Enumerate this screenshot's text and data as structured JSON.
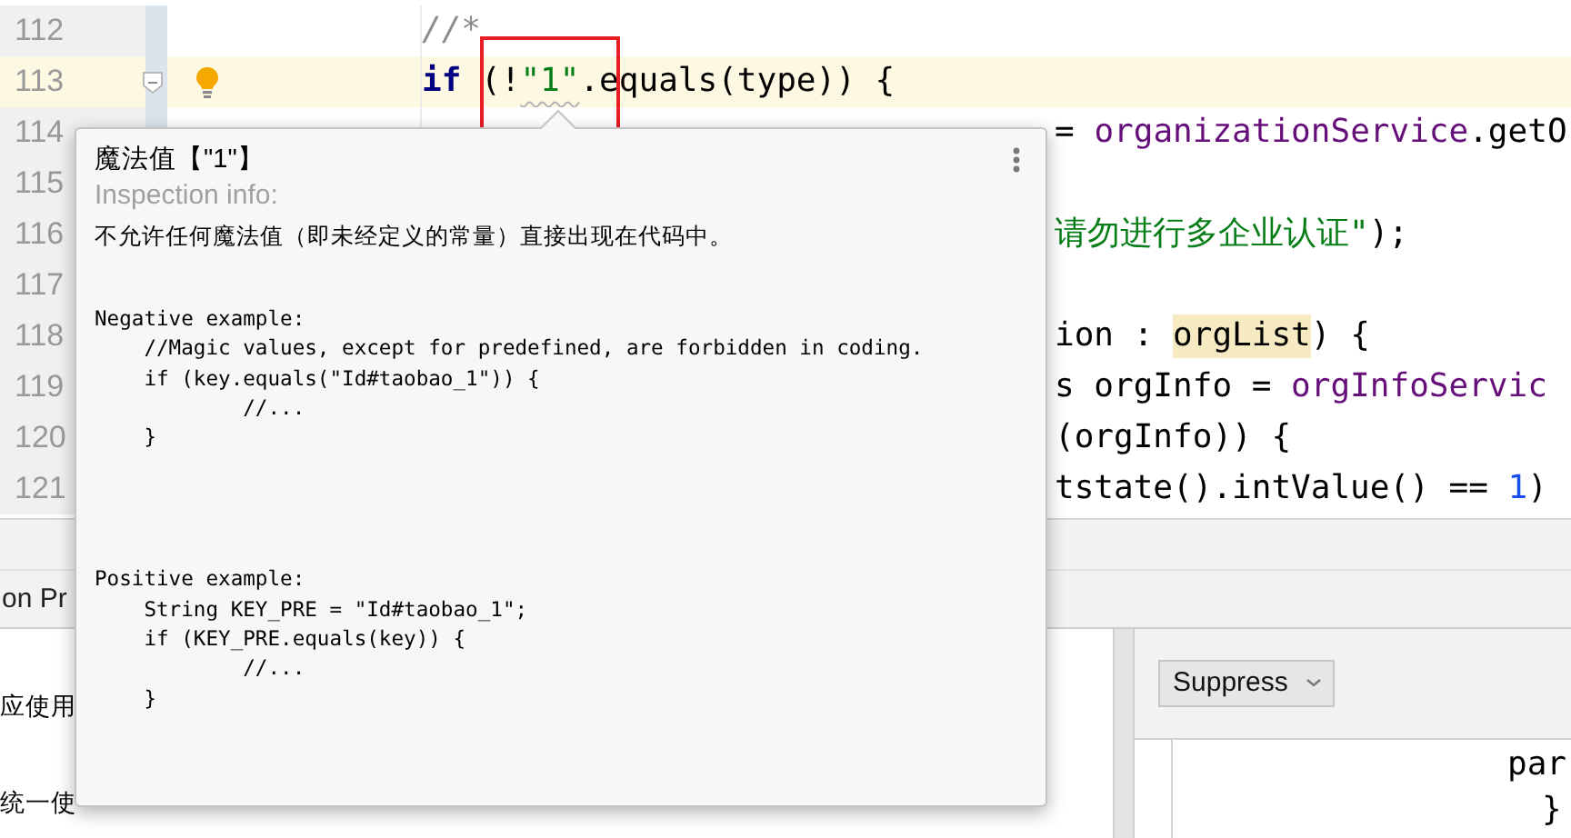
{
  "editor": {
    "lines": [
      {
        "number": "112",
        "current": false,
        "covered": false,
        "bulb": false,
        "tokens": [
          {
            "kind": "comment",
            "text": "//*"
          }
        ]
      },
      {
        "number": "113",
        "current": true,
        "covered": false,
        "bulb": true,
        "tokens": [
          {
            "kind": "keyword",
            "text": "if"
          },
          {
            "kind": "plain",
            "text": " (!"
          },
          {
            "kind": "string",
            "text": "\"1\""
          },
          {
            "kind": "plain",
            "text": ".equals(type)) {"
          }
        ]
      },
      {
        "number": "114",
        "current": false,
        "covered": true,
        "bulb": false,
        "tokens": [
          {
            "kind": "plain",
            "text": "= "
          },
          {
            "kind": "field",
            "text": "organizationService"
          },
          {
            "kind": "plain",
            "text": ".getO"
          }
        ]
      },
      {
        "number": "115",
        "current": false
      },
      {
        "number": "116",
        "current": false,
        "covered": true,
        "bulb": false,
        "tokens": [
          {
            "kind": "string",
            "text": "请勿进行多企业认证\""
          },
          {
            "kind": "plain",
            "text": ");"
          }
        ]
      },
      {
        "number": "117",
        "current": false
      },
      {
        "number": "118",
        "current": false,
        "covered": true,
        "bulb": false,
        "tokens": [
          {
            "kind": "plain",
            "text": "ion : "
          },
          {
            "kind": "match",
            "text": "orgList"
          },
          {
            "kind": "plain",
            "text": ") {"
          }
        ]
      },
      {
        "number": "119",
        "current": false,
        "covered": true,
        "bulb": false,
        "tokens": [
          {
            "kind": "plain",
            "text": "s orgInfo = "
          },
          {
            "kind": "field",
            "text": "orgInfoServic"
          }
        ]
      },
      {
        "number": "120",
        "current": false,
        "covered": true,
        "bulb": false,
        "tokens": [
          {
            "kind": "plain",
            "text": "(orgInfo)) {"
          }
        ]
      },
      {
        "number": "121",
        "current": false,
        "covered": true,
        "bulb": false,
        "tokens": [
          {
            "kind": "plain",
            "text": "tstate().intValue() == "
          },
          {
            "kind": "number",
            "text": "1"
          },
          {
            "kind": "plain",
            "text": ")"
          }
        ]
      }
    ]
  },
  "inspection_popup": {
    "title": "魔法值【\"1\"】",
    "subtitle": "Inspection info:",
    "description": "不允许任何魔法值（即未经定义的常量）直接出现在代码中。",
    "examples": [
      {
        "heading": "Negative example:",
        "code": "    //Magic values, except for predefined, are forbidden in coding.\n    if (key.equals(\"Id#taobao_1\")) {\n            //...\n    }"
      },
      {
        "heading": "Positive example:",
        "code": "    String KEY_PRE = \"Id#taobao_1\";\n    if (KEY_PRE.equals(key)) {\n            //...\n    }"
      }
    ]
  },
  "bottom_panel": {
    "tab": "on Pr",
    "lines": [
      "应使用",
      "统一使"
    ]
  },
  "right_panel": {
    "button": "Suppress",
    "code": [
      "par",
      "}"
    ]
  }
}
